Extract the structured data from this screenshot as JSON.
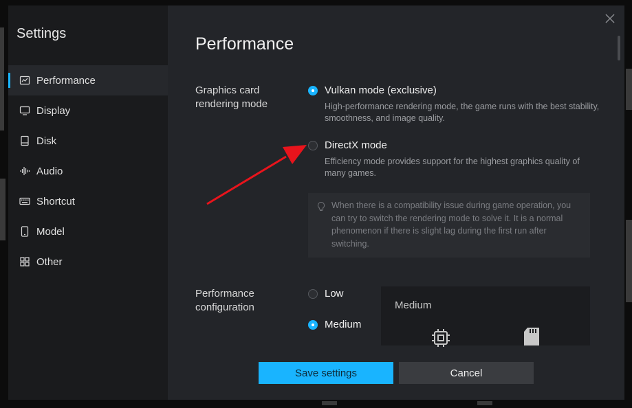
{
  "sidebar": {
    "title": "Settings",
    "items": [
      {
        "label": "Performance",
        "icon": "chart-icon",
        "active": true
      },
      {
        "label": "Display",
        "icon": "monitor-icon"
      },
      {
        "label": "Disk",
        "icon": "disk-icon"
      },
      {
        "label": "Audio",
        "icon": "audio-icon"
      },
      {
        "label": "Shortcut",
        "icon": "keyboard-icon"
      },
      {
        "label": "Model",
        "icon": "phone-icon"
      },
      {
        "label": "Other",
        "icon": "grid-icon"
      }
    ]
  },
  "main": {
    "title": "Performance",
    "rendering": {
      "label": "Graphics card rendering mode",
      "options": [
        {
          "label": "Vulkan mode (exclusive)",
          "desc": "High-performance rendering mode, the game runs with the best stability, smoothness, and image quality.",
          "checked": true
        },
        {
          "label": "DirectX mode",
          "desc": "Efficiency mode provides support for the highest graphics quality of many games.",
          "checked": false
        }
      ],
      "tip": "When there is a compatibility issue during game operation, you can try to switch the rendering mode to solve it. It is a normal phenomenon if there is slight lag during the first run after switching."
    },
    "performance": {
      "label": "Performance configuration",
      "options": [
        {
          "label": "Low",
          "checked": false
        },
        {
          "label": "Medium",
          "checked": true
        }
      ],
      "preview_title": "Medium"
    }
  },
  "buttons": {
    "save": "Save settings",
    "cancel": "Cancel"
  },
  "colors": {
    "accent": "#19b4ff",
    "annotation": "#e8141c"
  }
}
